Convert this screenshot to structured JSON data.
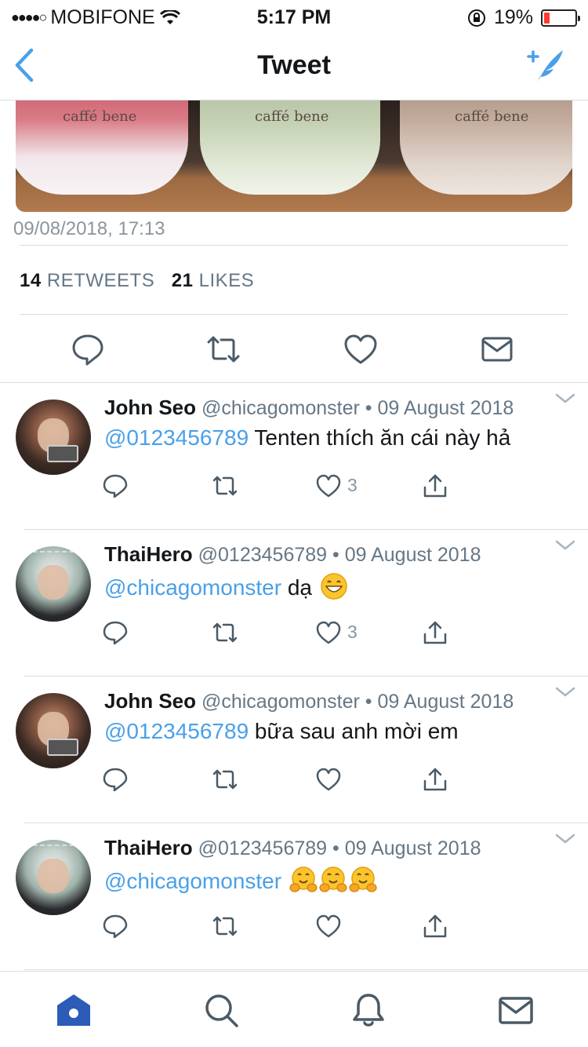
{
  "status_bar": {
    "signal": "●●●●○",
    "carrier": "MOBIFONE",
    "time": "5:17 PM",
    "battery_percent": "19%",
    "battery_level": 0.19,
    "battery_color": "#ff3b30"
  },
  "nav": {
    "title": "Tweet",
    "back_icon": "chevron-left-icon",
    "compose_icon": "compose-tweet-icon",
    "accent": "#4aa0e8"
  },
  "tweet": {
    "photo_brand_labels": [
      "caffé bene",
      "caffé bene",
      "caffé bene"
    ],
    "timestamp": "09/08/2018, 17:13",
    "retweets_count": "14",
    "retweets_label": "RETWEETS",
    "likes_count": "21",
    "likes_label": "LIKES",
    "actions": [
      "reply-icon",
      "retweet-icon",
      "like-icon",
      "message-icon"
    ]
  },
  "replies": [
    {
      "name": "John Seo",
      "handle": "@chicagomonster",
      "dot": "•",
      "date": "09 August 2018",
      "mention": "@0123456789",
      "text": " Tenten thích ăn cái này hả",
      "emoji": [],
      "like_count": "3"
    },
    {
      "name": "ThaiHero",
      "handle": "@0123456789",
      "dot": "•",
      "date": "09 August 2018",
      "mention": "@chicagomonster",
      "text": " dạ ",
      "emoji": [
        "grinning-face"
      ],
      "like_count": "3"
    },
    {
      "name": "John Seo",
      "handle": "@chicagomonster",
      "dot": "•",
      "date": "09 August 2018",
      "mention": "@0123456789",
      "text": " bữa sau anh mời em",
      "emoji": [],
      "like_count": ""
    },
    {
      "name": "ThaiHero",
      "handle": "@0123456789",
      "dot": "•",
      "date": "09 August 2018",
      "mention": "@chicagomonster",
      "text": " ",
      "emoji": [
        "hugging-face",
        "hugging-face",
        "hugging-face"
      ],
      "like_count": ""
    }
  ],
  "tab_bar": {
    "items": [
      "home-icon",
      "search-icon",
      "notifications-icon",
      "messages-icon"
    ],
    "active": "home-icon",
    "active_color": "#2c5bb8",
    "inactive_color": "#4a5a66"
  }
}
